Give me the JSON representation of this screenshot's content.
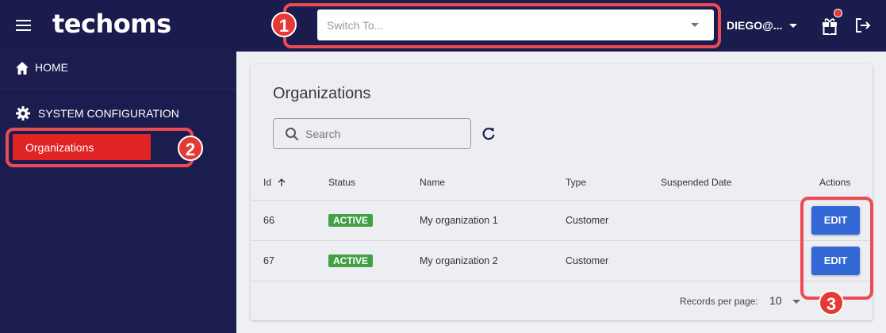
{
  "header": {
    "logo_text": "techoms",
    "switch_placeholder": "Switch To...",
    "user_label": "DIEGO@...",
    "callout_1": "1"
  },
  "sidebar": {
    "items": [
      {
        "label": "HOME",
        "icon": "home-icon"
      },
      {
        "label": "SYSTEM CONFIGURATION",
        "icon": "gear-icon"
      },
      {
        "label": "Organizations",
        "active": true
      }
    ],
    "callout_2": "2"
  },
  "main": {
    "title": "Organizations",
    "search_placeholder": "Search",
    "columns": [
      "Id",
      "Status",
      "Name",
      "Type",
      "Suspended Date",
      "Actions"
    ],
    "rows": [
      {
        "id": "66",
        "status": "ACTIVE",
        "name": "My organization 1",
        "type": "Customer",
        "suspended_date": "",
        "action": "EDIT"
      },
      {
        "id": "67",
        "status": "ACTIVE",
        "name": "My organization 2",
        "type": "Customer",
        "suspended_date": "",
        "action": "EDIT"
      }
    ],
    "records_per_page_label": "Records per page:",
    "records_per_page_value": "10",
    "callout_3": "3"
  },
  "colors": {
    "header_bg": "#1b1c4e",
    "sidebar_bg": "#1c1d4f",
    "active_item": "#e02424",
    "status_active": "#43a047",
    "edit_button": "#3367d6",
    "callout": "#ee4a55"
  }
}
